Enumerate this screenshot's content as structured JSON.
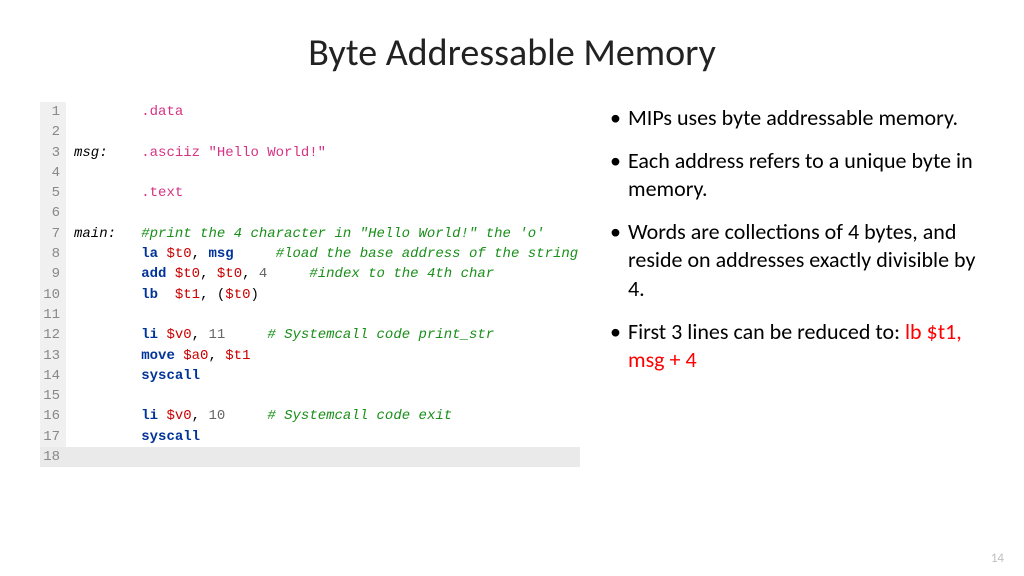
{
  "title": "Byte Addressable Memory",
  "code": {
    "lines": [
      {
        "n": "1",
        "lbl": "",
        "html": "<span class='dir'>.data</span>"
      },
      {
        "n": "2",
        "lbl": "",
        "html": ""
      },
      {
        "n": "3",
        "lbl": "msg:",
        "html": "<span class='dir'>.asciiz</span> <span class='str'>\"Hello World!\"</span>"
      },
      {
        "n": "4",
        "lbl": "",
        "html": ""
      },
      {
        "n": "5",
        "lbl": "",
        "html": "<span class='dir'>.text</span>"
      },
      {
        "n": "6",
        "lbl": "",
        "html": ""
      },
      {
        "n": "7",
        "lbl": "main:",
        "html": "<span class='cmt'>#print the 4 character in \"Hello World!\" the 'o'</span>"
      },
      {
        "n": "8",
        "lbl": "",
        "html": "<span class='ins'>la</span> <span class='reg'>$t0</span>, <span class='ins'>msg</span>     <span class='cmt'>#load the base address of the string</span>"
      },
      {
        "n": "9",
        "lbl": "",
        "html": "<span class='ins'>add</span> <span class='reg'>$t0</span>, <span class='reg'>$t0</span>, <span class='num'>4</span>     <span class='cmt'>#index to the 4th char</span>"
      },
      {
        "n": "10",
        "lbl": "",
        "html": "<span class='ins'>lb</span>  <span class='reg'>$t1</span>, (<span class='reg'>$t0</span>)"
      },
      {
        "n": "11",
        "lbl": "",
        "html": ""
      },
      {
        "n": "12",
        "lbl": "",
        "html": "<span class='ins'>li</span> <span class='reg'>$v0</span>, <span class='num'>11</span>     <span class='cmt'># Systemcall code print_str</span>"
      },
      {
        "n": "13",
        "lbl": "",
        "html": "<span class='ins'>move</span> <span class='reg'>$a0</span>, <span class='reg'>$t1</span>"
      },
      {
        "n": "14",
        "lbl": "",
        "html": "<span class='ins'>syscall</span>"
      },
      {
        "n": "15",
        "lbl": "",
        "html": ""
      },
      {
        "n": "16",
        "lbl": "",
        "html": "<span class='ins'>li</span> <span class='reg'>$v0</span>, <span class='num'>10</span>     <span class='cmt'># Systemcall code exit</span>"
      },
      {
        "n": "17",
        "lbl": "",
        "html": "<span class='ins'>syscall</span>"
      },
      {
        "n": "18",
        "lbl": "",
        "html": "",
        "last": true
      }
    ]
  },
  "bullets": [
    {
      "text": "MIPs uses byte addressable memory."
    },
    {
      "text": "Each address refers to a unique byte in memory."
    },
    {
      "text": "Words are collections of 4 bytes, and reside on addresses exactly divisible by 4."
    },
    {
      "text": "First 3 lines can be reduced to:  ",
      "red": "lb $t1, msg + 4"
    }
  ],
  "page": "14"
}
